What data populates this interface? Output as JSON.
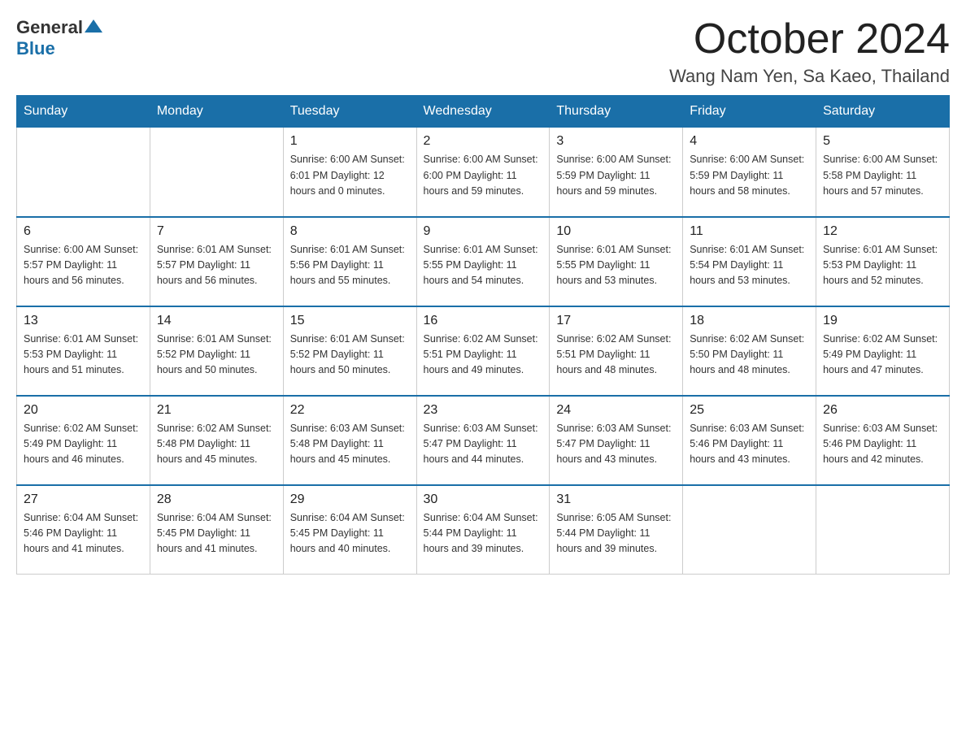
{
  "header": {
    "logo_general": "General",
    "logo_blue": "Blue",
    "month_title": "October 2024",
    "location": "Wang Nam Yen, Sa Kaeo, Thailand"
  },
  "weekdays": [
    "Sunday",
    "Monday",
    "Tuesday",
    "Wednesday",
    "Thursday",
    "Friday",
    "Saturday"
  ],
  "weeks": [
    [
      {
        "day": "",
        "info": ""
      },
      {
        "day": "",
        "info": ""
      },
      {
        "day": "1",
        "info": "Sunrise: 6:00 AM\nSunset: 6:01 PM\nDaylight: 12 hours\nand 0 minutes."
      },
      {
        "day": "2",
        "info": "Sunrise: 6:00 AM\nSunset: 6:00 PM\nDaylight: 11 hours\nand 59 minutes."
      },
      {
        "day": "3",
        "info": "Sunrise: 6:00 AM\nSunset: 5:59 PM\nDaylight: 11 hours\nand 59 minutes."
      },
      {
        "day": "4",
        "info": "Sunrise: 6:00 AM\nSunset: 5:59 PM\nDaylight: 11 hours\nand 58 minutes."
      },
      {
        "day": "5",
        "info": "Sunrise: 6:00 AM\nSunset: 5:58 PM\nDaylight: 11 hours\nand 57 minutes."
      }
    ],
    [
      {
        "day": "6",
        "info": "Sunrise: 6:00 AM\nSunset: 5:57 PM\nDaylight: 11 hours\nand 56 minutes."
      },
      {
        "day": "7",
        "info": "Sunrise: 6:01 AM\nSunset: 5:57 PM\nDaylight: 11 hours\nand 56 minutes."
      },
      {
        "day": "8",
        "info": "Sunrise: 6:01 AM\nSunset: 5:56 PM\nDaylight: 11 hours\nand 55 minutes."
      },
      {
        "day": "9",
        "info": "Sunrise: 6:01 AM\nSunset: 5:55 PM\nDaylight: 11 hours\nand 54 minutes."
      },
      {
        "day": "10",
        "info": "Sunrise: 6:01 AM\nSunset: 5:55 PM\nDaylight: 11 hours\nand 53 minutes."
      },
      {
        "day": "11",
        "info": "Sunrise: 6:01 AM\nSunset: 5:54 PM\nDaylight: 11 hours\nand 53 minutes."
      },
      {
        "day": "12",
        "info": "Sunrise: 6:01 AM\nSunset: 5:53 PM\nDaylight: 11 hours\nand 52 minutes."
      }
    ],
    [
      {
        "day": "13",
        "info": "Sunrise: 6:01 AM\nSunset: 5:53 PM\nDaylight: 11 hours\nand 51 minutes."
      },
      {
        "day": "14",
        "info": "Sunrise: 6:01 AM\nSunset: 5:52 PM\nDaylight: 11 hours\nand 50 minutes."
      },
      {
        "day": "15",
        "info": "Sunrise: 6:01 AM\nSunset: 5:52 PM\nDaylight: 11 hours\nand 50 minutes."
      },
      {
        "day": "16",
        "info": "Sunrise: 6:02 AM\nSunset: 5:51 PM\nDaylight: 11 hours\nand 49 minutes."
      },
      {
        "day": "17",
        "info": "Sunrise: 6:02 AM\nSunset: 5:51 PM\nDaylight: 11 hours\nand 48 minutes."
      },
      {
        "day": "18",
        "info": "Sunrise: 6:02 AM\nSunset: 5:50 PM\nDaylight: 11 hours\nand 48 minutes."
      },
      {
        "day": "19",
        "info": "Sunrise: 6:02 AM\nSunset: 5:49 PM\nDaylight: 11 hours\nand 47 minutes."
      }
    ],
    [
      {
        "day": "20",
        "info": "Sunrise: 6:02 AM\nSunset: 5:49 PM\nDaylight: 11 hours\nand 46 minutes."
      },
      {
        "day": "21",
        "info": "Sunrise: 6:02 AM\nSunset: 5:48 PM\nDaylight: 11 hours\nand 45 minutes."
      },
      {
        "day": "22",
        "info": "Sunrise: 6:03 AM\nSunset: 5:48 PM\nDaylight: 11 hours\nand 45 minutes."
      },
      {
        "day": "23",
        "info": "Sunrise: 6:03 AM\nSunset: 5:47 PM\nDaylight: 11 hours\nand 44 minutes."
      },
      {
        "day": "24",
        "info": "Sunrise: 6:03 AM\nSunset: 5:47 PM\nDaylight: 11 hours\nand 43 minutes."
      },
      {
        "day": "25",
        "info": "Sunrise: 6:03 AM\nSunset: 5:46 PM\nDaylight: 11 hours\nand 43 minutes."
      },
      {
        "day": "26",
        "info": "Sunrise: 6:03 AM\nSunset: 5:46 PM\nDaylight: 11 hours\nand 42 minutes."
      }
    ],
    [
      {
        "day": "27",
        "info": "Sunrise: 6:04 AM\nSunset: 5:46 PM\nDaylight: 11 hours\nand 41 minutes."
      },
      {
        "day": "28",
        "info": "Sunrise: 6:04 AM\nSunset: 5:45 PM\nDaylight: 11 hours\nand 41 minutes."
      },
      {
        "day": "29",
        "info": "Sunrise: 6:04 AM\nSunset: 5:45 PM\nDaylight: 11 hours\nand 40 minutes."
      },
      {
        "day": "30",
        "info": "Sunrise: 6:04 AM\nSunset: 5:44 PM\nDaylight: 11 hours\nand 39 minutes."
      },
      {
        "day": "31",
        "info": "Sunrise: 6:05 AM\nSunset: 5:44 PM\nDaylight: 11 hours\nand 39 minutes."
      },
      {
        "day": "",
        "info": ""
      },
      {
        "day": "",
        "info": ""
      }
    ]
  ]
}
